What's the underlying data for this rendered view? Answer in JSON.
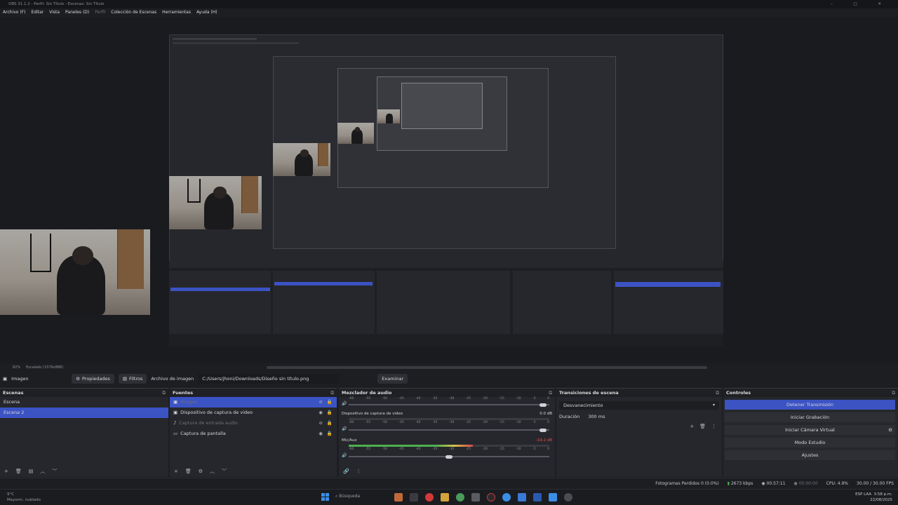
{
  "window": {
    "title": "OBS 31.1.2 - Perfil: Sin Título - Escenas: Sin Título",
    "controls": "–  □  ✕"
  },
  "menu": [
    "Archivo (F)",
    "Editar",
    "Vista",
    "Paneles (D)",
    "Perfil",
    "Colección de Escenas",
    "Herramientas",
    "Ayuda (H)"
  ],
  "preview_status": {
    "zoom": "82%",
    "scale": "Escalado (1579x888)"
  },
  "source_toolbar": {
    "source_name": "Imagen",
    "properties": "Propiedades",
    "filters": "Filtros",
    "file_label": "Archivo de imagen",
    "file_path": "C:/Users/jhoni/Downloads/Diseño sin título.png",
    "browse": "Examinar"
  },
  "scenes": {
    "title": "Escenas",
    "items": [
      {
        "label": "Escena",
        "selected": false
      },
      {
        "label": "Escena 2",
        "selected": true
      }
    ]
  },
  "sources": {
    "title": "Fuentes",
    "items": [
      {
        "label": "Imagen",
        "selected": true,
        "visible": false
      },
      {
        "label": "Dispositivo de captura de video",
        "selected": false,
        "visible": true
      },
      {
        "label": "Captura de entrada audio",
        "selected": false,
        "visible": false
      },
      {
        "label": "Captura de pantalla",
        "selected": false,
        "visible": true
      }
    ]
  },
  "mixer": {
    "title": "Mezclador de audio",
    "channels": [
      {
        "name": "",
        "level": "",
        "meter_fill": 0.0,
        "volume": 0.97
      },
      {
        "name": "Dispositivo de captura de video",
        "level": "0.0 dB",
        "meter_fill": 0.0,
        "volume": 0.97
      },
      {
        "name": "Mic/Aux",
        "level": "-19.2 dB",
        "meter_fill": 0.62,
        "volume": 0.5
      }
    ],
    "ticks": [
      "-60",
      "-55",
      "-50",
      "-45",
      "-40",
      "-35",
      "-30",
      "-25",
      "-20",
      "-15",
      "-10",
      "-5",
      "0"
    ]
  },
  "transitions": {
    "title": "Transiciones de escena",
    "selected": "Desvanecimiento",
    "duration_label": "Duración",
    "duration_value": "300 ms"
  },
  "controls": {
    "title": "Controles",
    "buttons": [
      {
        "label": "Detener Transmisión",
        "primary": true
      },
      {
        "label": "Iniciar Grabación",
        "primary": false
      },
      {
        "label": "Iniciar Cámara Virtual",
        "primary": false
      },
      {
        "label": "Modo Estudio",
        "primary": false
      },
      {
        "label": "Ajustes",
        "primary": false
      }
    ]
  },
  "status_bar": {
    "dropped": "Fotogramas Perdidos 0 (0.0%)",
    "bitrate": "2673 kbps",
    "stream_time": "00:57:11",
    "rec_time": "00:00:00",
    "cpu": "CPU: 4.9%",
    "fps": "30.00 / 30.00 FPS"
  },
  "taskbar": {
    "weather_temp": "9°C",
    "weather_desc": "Mayorm. nublado",
    "search": "Búsqueda",
    "lang": "ESP LAA",
    "time": "3:58 p.m.",
    "date": "22/08/2025"
  },
  "colors": {
    "accent": "#3c53c4",
    "panel": "#26272c",
    "background": "#1d1e22"
  }
}
